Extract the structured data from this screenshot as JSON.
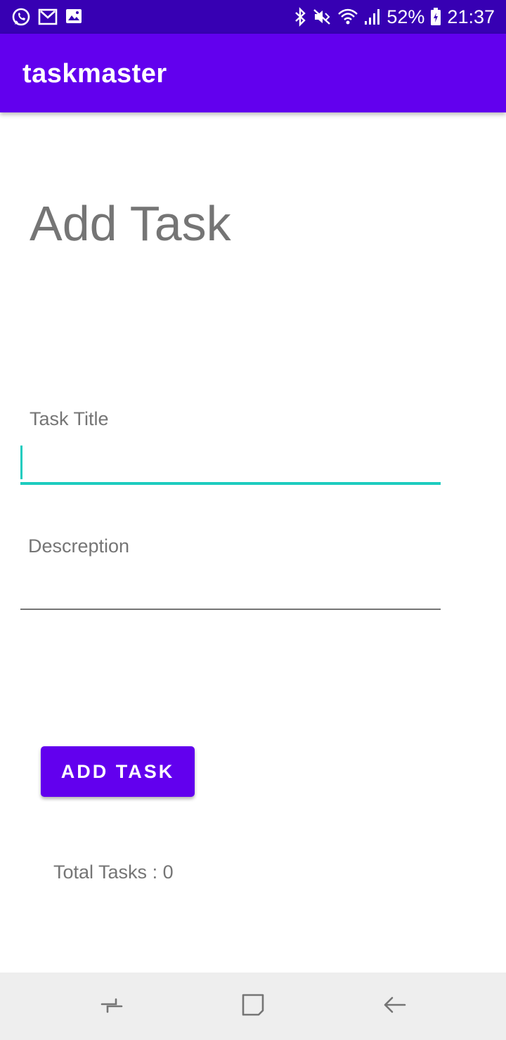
{
  "status_bar": {
    "left_icons": [
      "whatsapp-icon",
      "gmail-icon",
      "image-icon"
    ],
    "right_icons": [
      "bluetooth-icon",
      "mute-icon",
      "wifi-icon",
      "signal-icon",
      "battery-icon"
    ],
    "battery": "52%",
    "time": "21:37",
    "colors": {
      "background": "#3700b3",
      "foreground": "#ffffff"
    }
  },
  "app_bar": {
    "title": "taskmaster",
    "color": "#6200ee"
  },
  "page": {
    "heading": "Add Task"
  },
  "form": {
    "title_label": "Task Title",
    "title_value": "",
    "title_accent_color": "#1dccbf",
    "description_label": "Descreption",
    "description_value": "",
    "button_label": "ADD TASK",
    "button_color": "#6200ee"
  },
  "summary": {
    "total_tasks": "Total Tasks : 0"
  },
  "nav_bar": {
    "buttons": [
      "recent-apps-icon",
      "home-icon",
      "back-icon"
    ],
    "background": "#eeeeee"
  }
}
